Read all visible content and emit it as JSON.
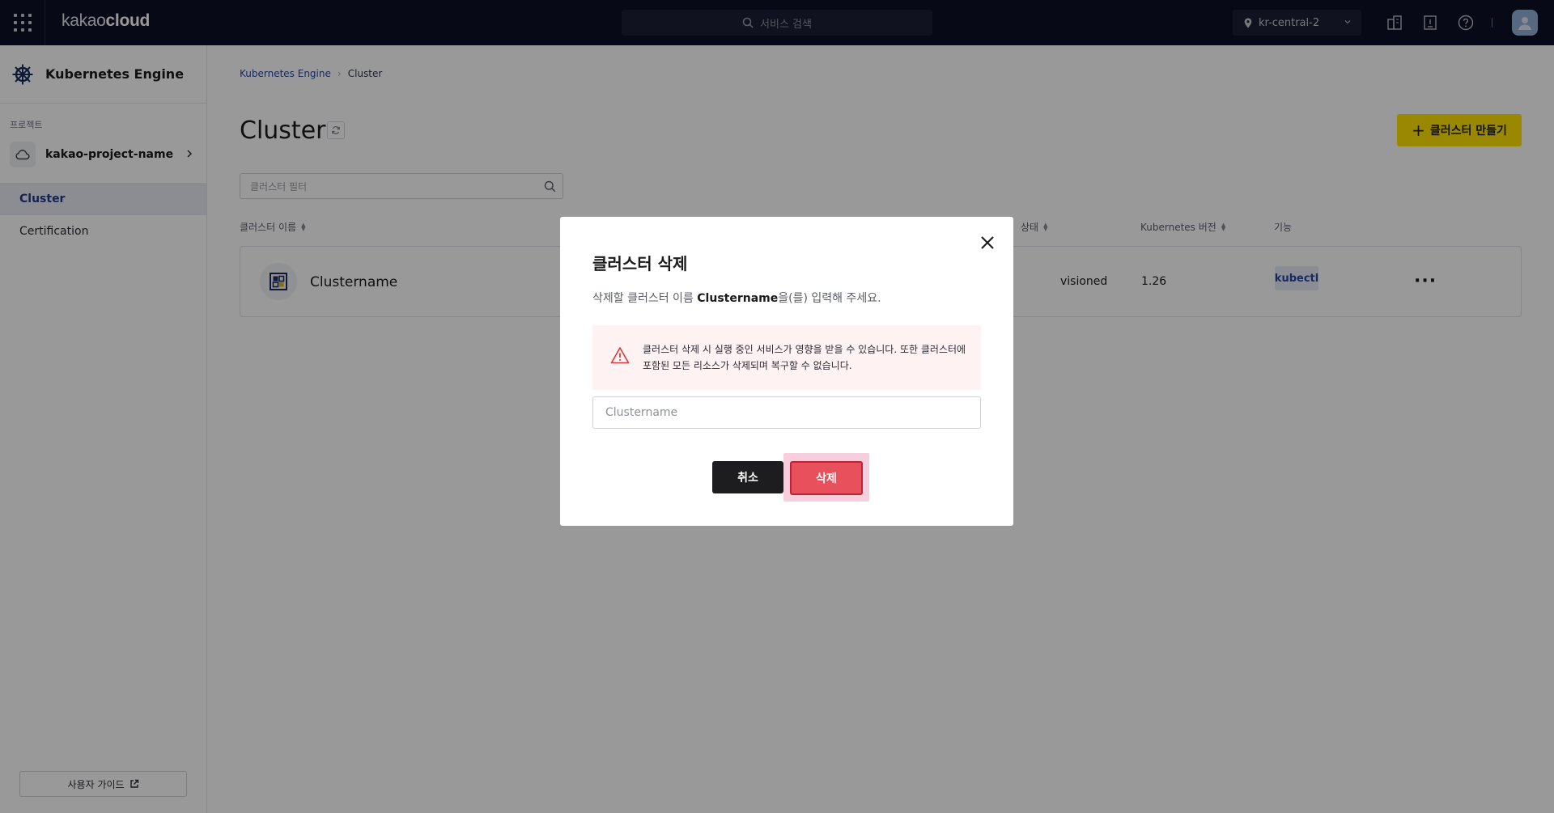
{
  "topbar": {
    "logo_light": "kakao",
    "logo_bold": "cloud",
    "search_placeholder": "서비스 검색",
    "region": "kr-central-2"
  },
  "sidebar": {
    "service_title": "Kubernetes Engine",
    "project_label": "프로젝트",
    "project_name": "kakao-project-name",
    "items": [
      {
        "label": "Cluster",
        "active": true
      },
      {
        "label": "Certification",
        "active": false
      }
    ],
    "guide_label": "사용자 가이드"
  },
  "main": {
    "breadcrumb": [
      "Kubernetes Engine",
      "Cluster"
    ],
    "title": "Cluster",
    "create_button": "클러스터 만들기",
    "filter_placeholder": "클러스터 필터",
    "columns": {
      "name": "클러스터 이름",
      "status": "상태",
      "version": "Kubernetes 버전",
      "features": "기능"
    },
    "rows": [
      {
        "name": "Clustername",
        "status": "visioned",
        "version": "1.26",
        "feature": "kubectl"
      }
    ]
  },
  "modal": {
    "title": "클러스터 삭제",
    "desc_prefix": "삭제할 클러스터 이름 ",
    "desc_name": "Clustername",
    "desc_suffix": "을(를) 입력해 주세요.",
    "warning_line1": "클러스터 삭제 시 실행 중인 서비스가 영향을 받을 수 있습니다. 또한 클러스터에",
    "warning_line2": "포함된 모든 리소스가 삭제되며 복구할 수 없습니다.",
    "input_placeholder": "Clustername",
    "cancel_label": "취소",
    "delete_label": "삭제"
  },
  "colors": {
    "topbar": "#0c1125",
    "accent_yellow": "#ffe300",
    "danger": "#e8505b",
    "link_blue": "#2747a6"
  },
  "icons": [
    "apps-grid-icon",
    "search-icon",
    "location-pin-icon",
    "chevron-down-icon",
    "buildings-icon",
    "document-icon",
    "help-icon",
    "user-avatar-icon",
    "kubernetes-helm-icon",
    "cloud-icon",
    "chevron-right-icon",
    "external-link-icon",
    "refresh-icon",
    "plus-icon",
    "cluster-icon",
    "more-icon",
    "close-icon",
    "warning-icon"
  ]
}
